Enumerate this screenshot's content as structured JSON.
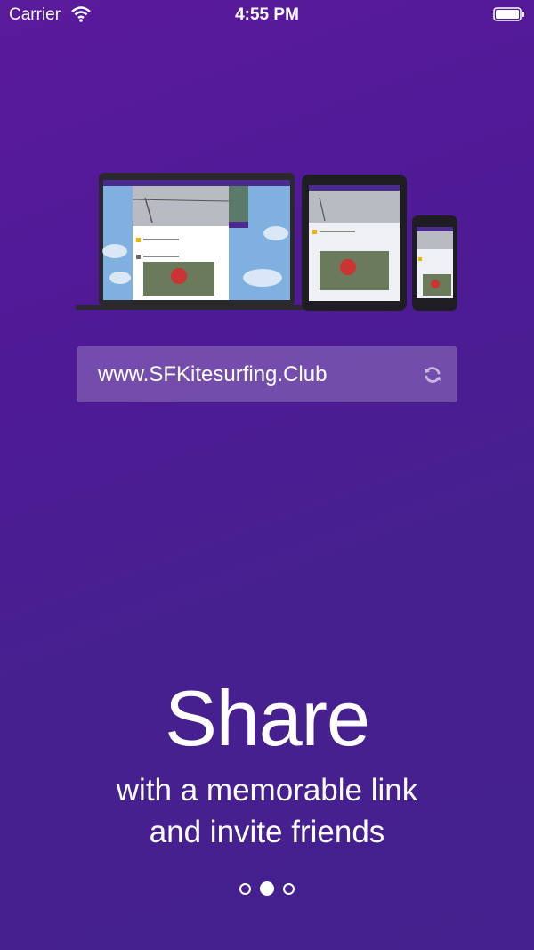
{
  "status": {
    "carrier": "Carrier",
    "time": "4:55 PM"
  },
  "url_bar": {
    "url": "www.SFKitesurfing.Club",
    "icon": "refresh-icon"
  },
  "onboarding": {
    "headline": "Share",
    "subtitle_line1": "with a memorable link",
    "subtitle_line2": "and invite friends",
    "page_count": 3,
    "active_page": 2
  },
  "colors": {
    "bg_top": "#5a1a9c",
    "bg_bottom": "#43208d",
    "accent": "#4a2a8c"
  }
}
